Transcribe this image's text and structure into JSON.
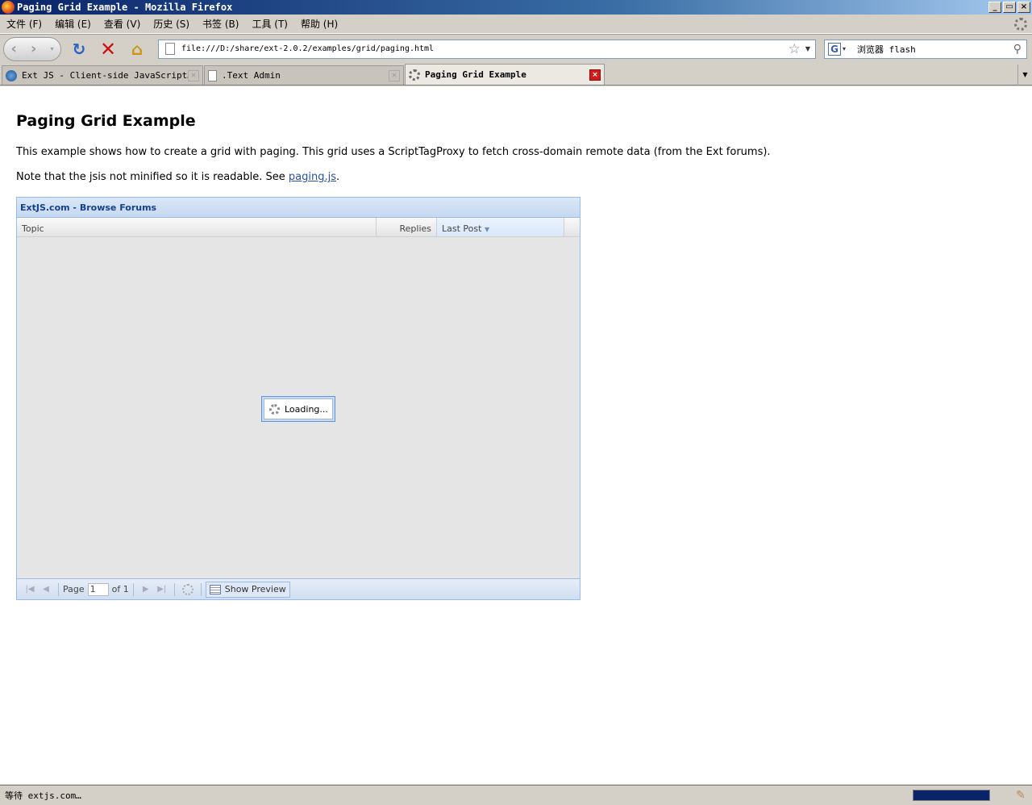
{
  "window": {
    "title": "Paging Grid Example - Mozilla Firefox"
  },
  "menu": [
    "文件 (F)",
    "编辑 (E)",
    "查看 (V)",
    "历史 (S)",
    "书签 (B)",
    "工具 (T)",
    "帮助 (H)"
  ],
  "nav": {
    "url": "file:///D:/share/ext-2.0.2/examples/grid/paging.html",
    "search_engine": "G",
    "search_text": "浏览器 flash"
  },
  "tabs": [
    {
      "label": "Ext JS - Client-side JavaScript…",
      "icon": "extjs-icon"
    },
    {
      "label": ".Text Admin",
      "icon": "page-icon"
    },
    {
      "label": "Paging Grid Example",
      "icon": "loading-icon"
    }
  ],
  "page": {
    "title": "Paging Grid Example",
    "para1": "This example shows how to create a grid with paging. This grid uses a ScriptTagProxy to fetch cross-domain remote data (from the Ext forums).",
    "para2_prefix": "Note that the jsis not minified so it is readable. See ",
    "para2_link": "paging.js",
    "para2_suffix": "."
  },
  "grid": {
    "title": "ExtJS.com - Browse Forums",
    "columns": {
      "topic": "Topic",
      "replies": "Replies",
      "last_post": "Last Post"
    },
    "loading_text": "Loading...",
    "pager": {
      "page_label": "Page",
      "page_value": "1",
      "of_label": "of 1",
      "preview_label": "Show Preview"
    }
  },
  "status": {
    "text": "等待 extjs.com…",
    "progress": 1.0
  },
  "colors": {
    "accent": "#15428b",
    "grid_border": "#99bbe8",
    "title_bar": "#0a246a"
  }
}
